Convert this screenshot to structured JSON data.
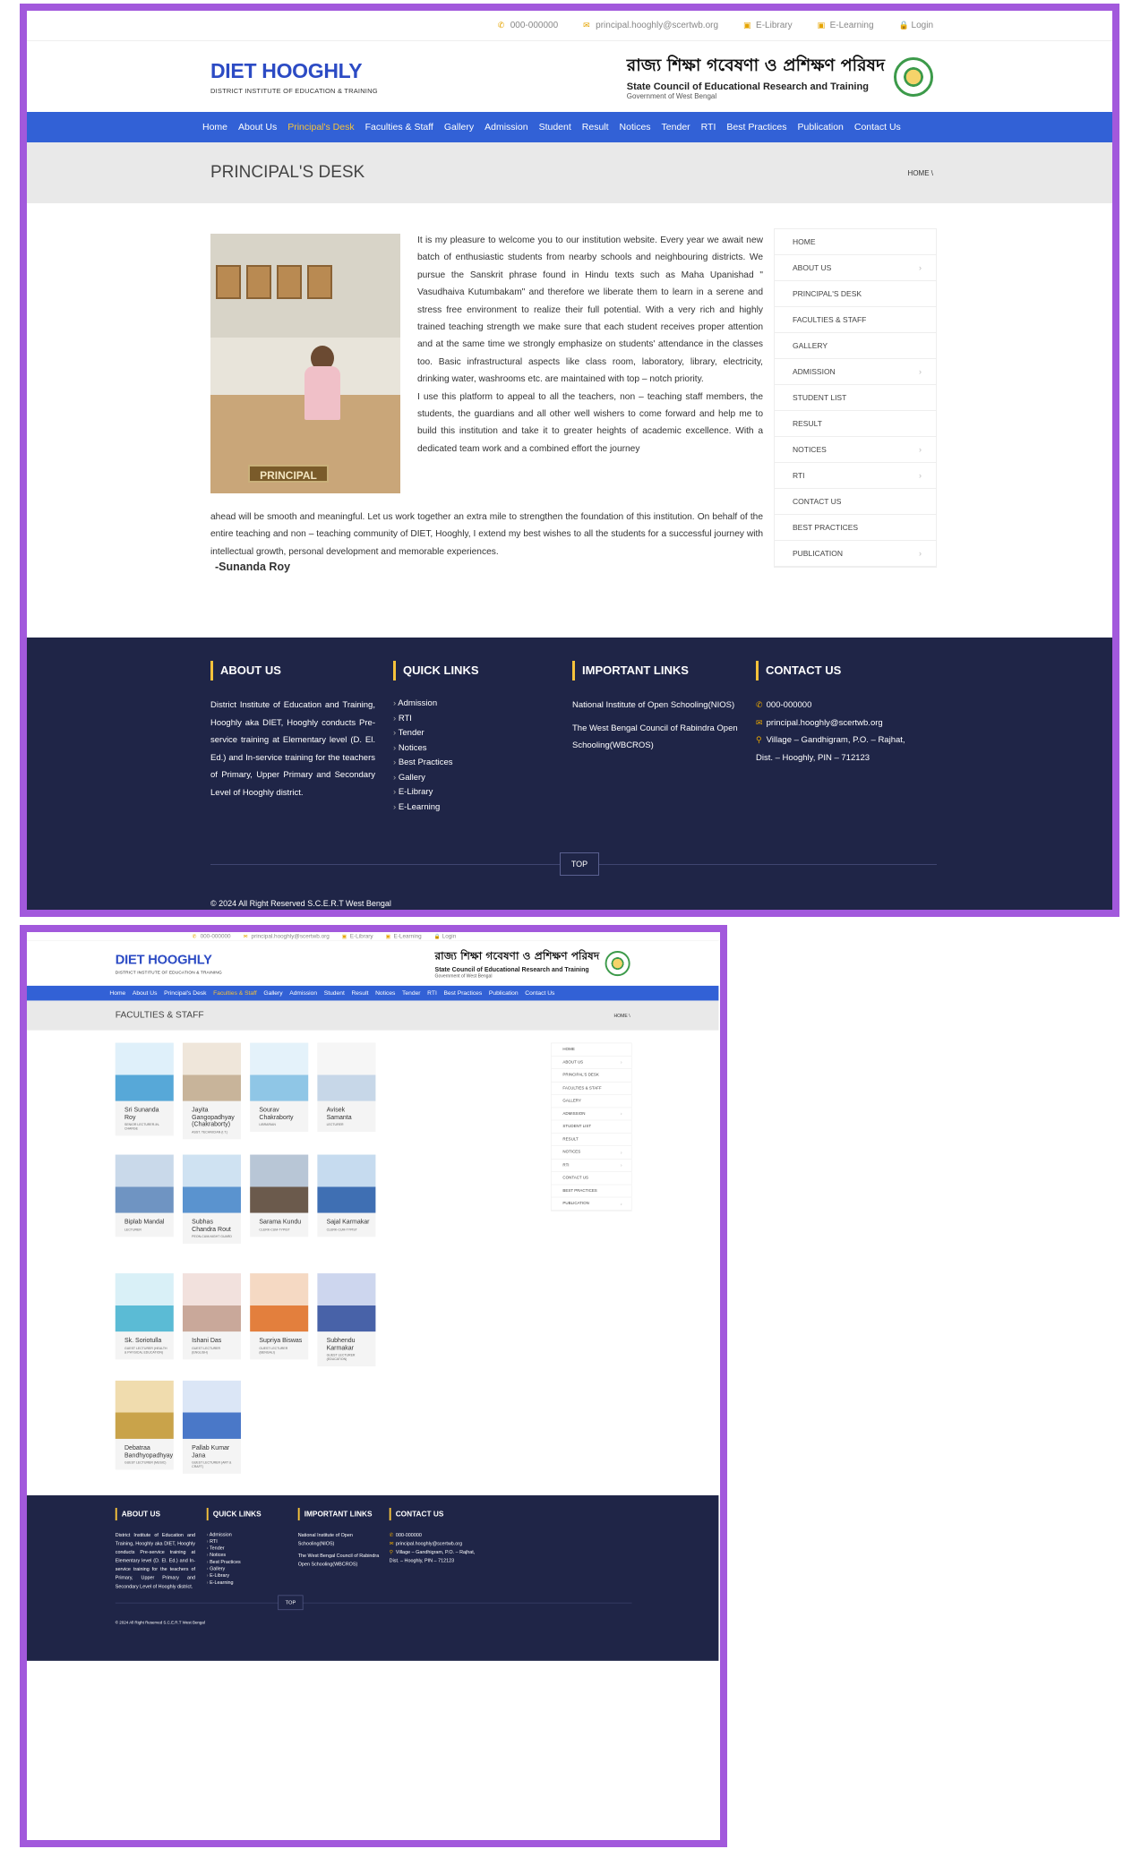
{
  "topbar": {
    "phone": "000-000000",
    "email": "principal.hooghly@scertwb.org",
    "elibrary": "E-Library",
    "elearning": "E-Learning",
    "login": "Login"
  },
  "brand": {
    "title": "DIET HOOGHLY",
    "subtitle": "DISTRICT INSTITUTE OF EDUCATION & TRAINING",
    "bengali": "রাজ্য শিক্ষা গবেষণা ও প্রশিক্ষণ পরিষদ",
    "council": "State Council of Educational Research and Training",
    "govt": "Government of West Bengal"
  },
  "nav": [
    "Home",
    "About Us",
    "Principal's Desk",
    "Faculties & Staff",
    "Gallery",
    "Admission",
    "Student",
    "Result",
    "Notices",
    "Tender",
    "RTI",
    "Best Practices",
    "Publication",
    "Contact Us"
  ],
  "page1": {
    "title": "PRINCIPAL'S DESK",
    "crumb": "HOME \\",
    "photo_label": "PRINCIPAL",
    "para1": "It is my pleasure to welcome you to our institution website. Every year we await new batch of enthusiastic students from nearby schools and neighbouring districts. We pursue the Sanskrit phrase found in Hindu texts such as Maha Upanishad \" Vasudhaiva Kutumbakam\" and therefore we liberate them to learn in a serene and stress free environment to realize their full potential. With a very rich and highly trained teaching strength we make sure that each student receives proper attention and at the same time we strongly emphasize on students' attendance in the classes too. Basic infrastructural aspects like class room, laboratory, library, electricity, drinking water, washrooms etc. are maintained with top – notch priority.",
    "para2a": "I use this platform to appeal to all the teachers, non – teaching staff members, the students, the guardians and all other well wishers to come forward and help me to build this institution and take it to greater heights of academic excellence. With a dedicated team work and a combined effort the journey",
    "para2b": "ahead will be smooth and meaningful. Let us work together an extra mile to strengthen the foundation of this institution. On behalf of the entire teaching and non – teaching community of DIET, Hooghly, I extend my best wishes to all the students for a successful journey with intellectual growth, personal development and memorable experiences.",
    "signature": "-Sunanda Roy"
  },
  "page2": {
    "title": "FACULTIES & STAFF",
    "crumb": "HOME \\",
    "staff": [
      {
        "name": "Sri Sunanda Roy",
        "role": "SENIOR LECTURER-IN-CHARGE"
      },
      {
        "name": "Jayita Gangopadhyay (Chakraborty)",
        "role": "ASST. TECHNICIAN (I.T.)"
      },
      {
        "name": "Sourav Chakraborty",
        "role": "LIBRARIAN"
      },
      {
        "name": "Avisek Samanta",
        "role": "LECTURER"
      },
      {
        "name": "Biplab Mandal",
        "role": "LECTURER"
      },
      {
        "name": "Subhas Chandra Rout",
        "role": "PEON-CUM-NIGHT GUARD"
      },
      {
        "name": "Sarama Kundu",
        "role": "CLERK-CUM-TYPIST"
      },
      {
        "name": "Sajal Karmakar",
        "role": "CLERK-CUM-TYPIST"
      },
      {
        "name": "Sk. Soriotulla",
        "role": "GUEST LECTURER (HEALTH & PHYSICAL EDUCATION)"
      },
      {
        "name": "Ishani Das",
        "role": "GUEST LECTURER (ENGLISH)"
      },
      {
        "name": "Supriya Biswas",
        "role": "GUEST LECTURER (BENGALI)"
      },
      {
        "name": "Subhendu Karmakar",
        "role": "GUEST LECTURER (EDUCATION)"
      },
      {
        "name": "Debatraa Bandhyopadhyay",
        "role": "GUEST LECTURER (MUSIC)"
      },
      {
        "name": "Pallab Kumar Jana",
        "role": "GUEST LECTURER (ART & CRAFT)"
      }
    ]
  },
  "sidebar": [
    {
      "label": "HOME",
      "chev": ""
    },
    {
      "label": "ABOUT US",
      "chev": "›"
    },
    {
      "label": "PRINCIPAL'S DESK",
      "chev": ""
    },
    {
      "label": "FACULTIES & STAFF",
      "chev": ""
    },
    {
      "label": "GALLERY",
      "chev": ""
    },
    {
      "label": "ADMISSION",
      "chev": "›"
    },
    {
      "label": "STUDENT LIST",
      "chev": ""
    },
    {
      "label": "RESULT",
      "chev": ""
    },
    {
      "label": "NOTICES",
      "chev": "›"
    },
    {
      "label": "RTI",
      "chev": "›"
    },
    {
      "label": "CONTACT US",
      "chev": ""
    },
    {
      "label": "BEST PRACTICES",
      "chev": ""
    },
    {
      "label": "PUBLICATION",
      "chev": "›"
    }
  ],
  "footer": {
    "about_h": "ABOUT US",
    "about": "District Institute of Education and Training, Hooghly aka DIET, Hooghly conducts Pre-service training at Elementary level (D. El. Ed.) and In-service training for the teachers of Primary, Upper Primary and Secondary Level of Hooghly district.",
    "quick_h": "QUICK LINKS",
    "quick": [
      "Admission",
      "RTI",
      "Tender",
      "Notices",
      "Best Practices",
      "Gallery",
      "E-Library",
      "E-Learning"
    ],
    "imp_h": "IMPORTANT LINKS",
    "imp1": "National Institute of Open Schooling(NIOS)",
    "imp2": "The West Bengal Council of Rabindra Open Schooling(WBCROS)",
    "contact_h": "CONTACT US",
    "phone": "000-000000",
    "email": "principal.hooghly@scertwb.org",
    "addr": "Village – Gandhigram, P.O. – Rajhat, Dist. – Hooghly, PIN – 712123",
    "top": "TOP",
    "copy": "© 2024 All Right Reserved S.C.E.R.T West Bengal"
  }
}
